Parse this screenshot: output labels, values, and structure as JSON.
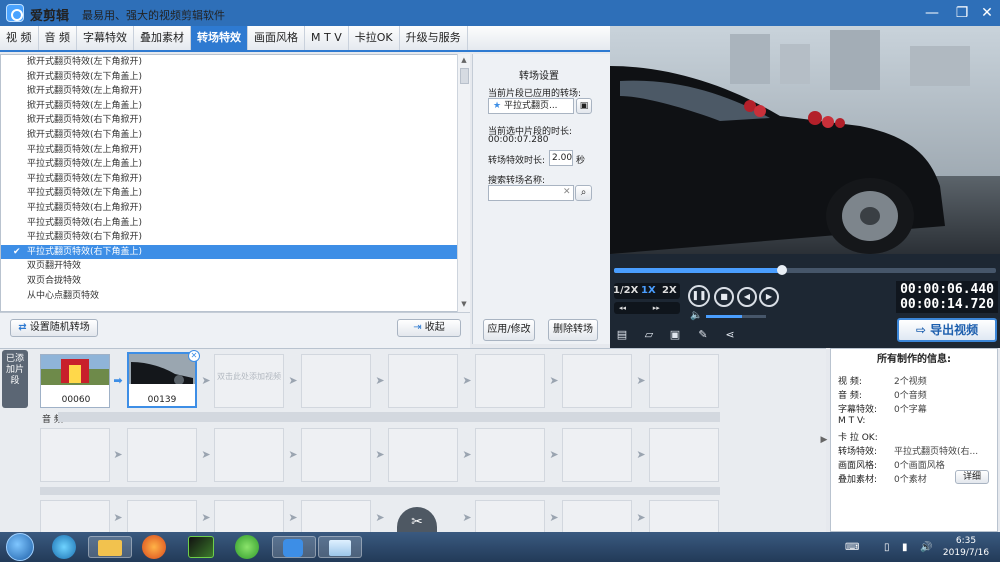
{
  "app": {
    "title": "爱剪辑",
    "slogan": "最易用、强大的视频剪辑软件"
  },
  "tabs": [
    "视 频",
    "音 频",
    "字幕特效",
    "叠加素材",
    "转场特效",
    "画面风格",
    "M T V",
    "卡拉OK",
    "升级与服务"
  ],
  "active_tab": "转场特效",
  "transition_list": [
    "掀开式翻页特效(左下角掀开)",
    "掀开式翻页特效(左下角盖上)",
    "掀开式翻页特效(左上角掀开)",
    "掀开式翻页特效(左上角盖上)",
    "掀开式翻页特效(右下角掀开)",
    "掀开式翻页特效(右下角盖上)",
    "平拉式翻页特效(左上角掀开)",
    "平拉式翻页特效(左上角盖上)",
    "平拉式翻页特效(左下角掀开)",
    "平拉式翻页特效(左下角盖上)",
    "平拉式翻页特效(右上角掀开)",
    "平拉式翻页特效(右上角盖上)",
    "平拉式翻页特效(右下角掀开)",
    "平拉式翻页特效(右下角盖上)",
    "双页翻开特效",
    "双页合拢特效",
    "从中心点翻页特效"
  ],
  "selected_index": 13,
  "list_buttons": {
    "random": "设置随机转场",
    "collapse": "收起"
  },
  "settings": {
    "header": "转场设置",
    "applied_label": "当前片段已应用的转场:",
    "applied_value": "平拉式翻页...",
    "duration_label": "当前选中片段的时长:",
    "duration_value": "00:00:07.280",
    "effect_duration_label": "转场特效时长:",
    "effect_duration_value": "2.00",
    "effect_duration_unit": "秒",
    "search_label": "搜索转场名称:",
    "search_value": "",
    "apply_button": "应用/修改",
    "delete_button": "删除转场"
  },
  "player": {
    "speeds": [
      "1/2X",
      "1X",
      "2X"
    ],
    "active_speed": "1X",
    "current_time": "00:00:06.440",
    "total_time": "00:00:14.720",
    "progress": 0.44,
    "volume": 0.6,
    "export_button": "导出视频"
  },
  "timeline": {
    "added_label": "已添加片段",
    "clips": [
      {
        "label": "00060"
      },
      {
        "label": "00139"
      }
    ],
    "empty_slot_text": "双击此处添加视频",
    "audio_label": "音 频"
  },
  "info": {
    "title": "所有制作的信息:",
    "rows": [
      {
        "key": "视 频:",
        "value": "2个视频"
      },
      {
        "key": "音 频:",
        "value": "0个音频"
      },
      {
        "key": "字幕特效:",
        "value": "0个字幕"
      },
      {
        "key": "M T V:",
        "value": ""
      },
      {
        "key": "卡 拉 OK:",
        "value": ""
      },
      {
        "key": "转场特效:",
        "value": "平拉式翻页特效(右..."
      },
      {
        "key": "画面风格:",
        "value": "0个画面风格"
      },
      {
        "key": "叠加素材:",
        "value": "0个素材"
      }
    ],
    "detail_button": "详细"
  },
  "taskbar": {
    "time": "6:35",
    "date": "2019/7/16"
  },
  "colors": {
    "accent": "#2e7ad1",
    "titlebar": "#2e6fb8",
    "selection": "#3d8ee6"
  }
}
